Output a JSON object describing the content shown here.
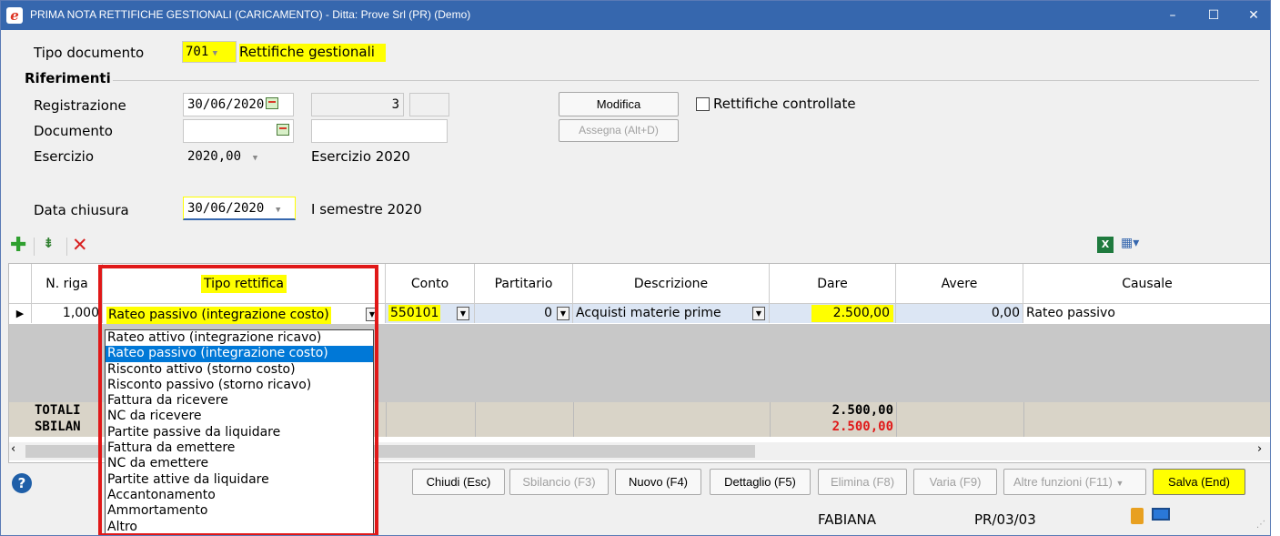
{
  "window": {
    "title": "PRIMA NOTA RETTIFICHE GESTIONALI (CARICAMENTO) - Ditta: Prove Srl (PR)  (Demo)",
    "icon": "e-logo-icon",
    "controls": [
      "–",
      "☐",
      "✕"
    ]
  },
  "tipo_documento": {
    "label": "Tipo documento",
    "code": "701",
    "description": "Rettifiche gestionali"
  },
  "riferimenti": {
    "section_title": "Riferimenti",
    "registrazione": {
      "label": "Registrazione",
      "date": "30/06/2020",
      "number": "3",
      "extra": ""
    },
    "documento": {
      "label": "Documento",
      "date": "",
      "number": ""
    },
    "esercizio": {
      "label": "Esercizio",
      "value": "2020,00",
      "description": "Esercizio 2020"
    }
  },
  "buttons_top": {
    "modifica": "Modifica",
    "assegna": "Assegna (Alt+D)"
  },
  "rettifiche_controllate": {
    "label": "Rettifiche controllate",
    "checked": false
  },
  "data_chiusura": {
    "label": "Data chiusura",
    "date": "30/06/2020",
    "description": "I semestre 2020"
  },
  "grid": {
    "columns": [
      "N. riga",
      "Tipo rettifica",
      "Conto",
      "Partitario",
      "Descrizione",
      "Dare",
      "Avere",
      "Causale"
    ],
    "rows": [
      {
        "n_riga": "1,000",
        "tipo_rettifica": "Rateo passivo (integrazione costo)",
        "conto": "550101",
        "partitario": "0",
        "descrizione": "Acquisti materie prime",
        "dare": "2.500,00",
        "avere": "0,00",
        "causale": "Rateo passivo"
      }
    ],
    "totali": {
      "label": "TOTALI",
      "dare": "2.500,00"
    },
    "sbilancio": {
      "label": "SBILAN",
      "dare": "2.500,00"
    }
  },
  "tipo_rettifica_options": [
    "Rateo attivo (integrazione ricavo)",
    "Rateo passivo (integrazione costo)",
    "Risconto attivo (storno costo)",
    "Risconto passivo (storno ricavo)",
    "Fattura da ricevere",
    "NC da ricevere",
    "Partite passive da liquidare",
    "Fattura da emettere",
    "NC da emettere",
    "Partite attive da liquidare",
    "Accantonamento",
    "Ammortamento",
    "Altro"
  ],
  "tipo_rettifica_selected_index": 1,
  "bottom_buttons": {
    "chiudi": "Chiudi (Esc)",
    "sbilancio": "Sbilancio (F3)",
    "nuovo": "Nuovo (F4)",
    "dettaglio": "Dettaglio (F5)",
    "elimina": "Elimina (F8)",
    "varia": "Varia (F9)",
    "altre": "Altre funzioni (F11)",
    "salva": "Salva (End)"
  },
  "status": {
    "user": "FABIANA",
    "code": "PR/03/03"
  },
  "colors": {
    "titlebar": "#3667ae",
    "highlight": "#ffff00",
    "selection": "#0078d7",
    "red_total": "#e01818",
    "red_box": "#e01818"
  }
}
